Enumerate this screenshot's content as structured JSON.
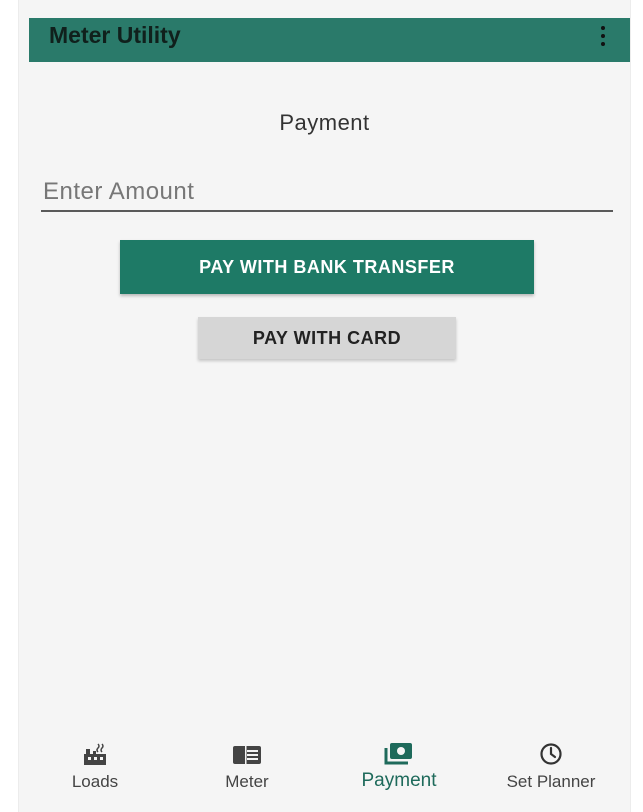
{
  "appbar": {
    "title": "Meter Utility",
    "overflow_icon": "more-vert-icon"
  },
  "page": {
    "title": "Payment"
  },
  "amount": {
    "placeholder": "Enter Amount",
    "value": ""
  },
  "buttons": {
    "bank_transfer": "PAY WITH BANK TRANSFER",
    "card": "PAY WITH CARD"
  },
  "nav": {
    "items": [
      {
        "label": "Loads",
        "icon": "factory-icon",
        "active": false
      },
      {
        "label": "Meter",
        "icon": "meter-icon",
        "active": false
      },
      {
        "label": "Payment",
        "icon": "payment-icon",
        "active": true
      },
      {
        "label": "Set Planner",
        "icon": "clock-icon",
        "active": false
      }
    ]
  },
  "colors": {
    "primary": "#1e7a66",
    "appbar": "#2a7a6a",
    "secondary_button": "#d6d6d6",
    "background": "#f5f5f5"
  }
}
